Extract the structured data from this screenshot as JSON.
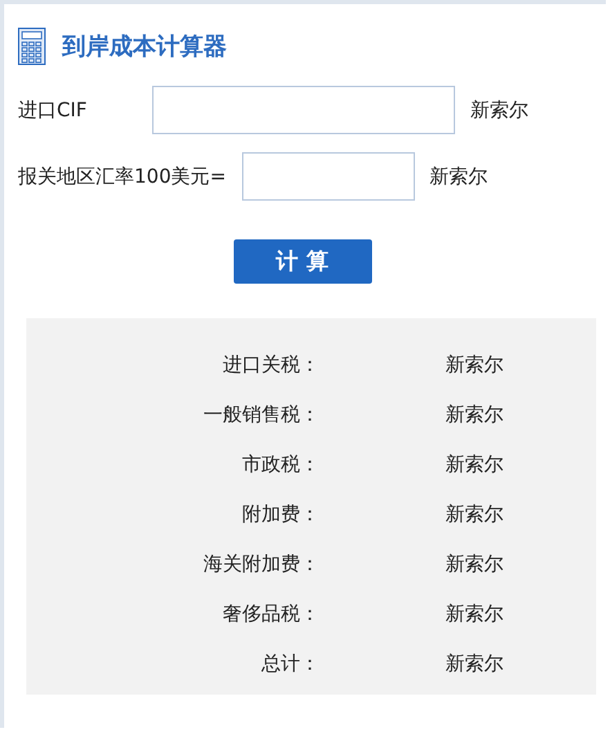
{
  "title": "到岸成本计算器",
  "fields": [
    {
      "label": "进口CIF",
      "unit": "新索尔",
      "wide": true
    },
    {
      "label": "报关地区汇率100美元=",
      "unit": "新索尔",
      "wide": false
    }
  ],
  "button": "计 算",
  "results": [
    {
      "label": "进口关税：",
      "unit": "新索尔"
    },
    {
      "label": "一般销售税：",
      "unit": "新索尔"
    },
    {
      "label": "市政税：",
      "unit": "新索尔"
    },
    {
      "label": "附加费：",
      "unit": "新索尔"
    },
    {
      "label": "海关附加费：",
      "unit": "新索尔"
    },
    {
      "label": "奢侈品税：",
      "unit": "新索尔"
    },
    {
      "label": "总计：",
      "unit": "新索尔"
    }
  ]
}
